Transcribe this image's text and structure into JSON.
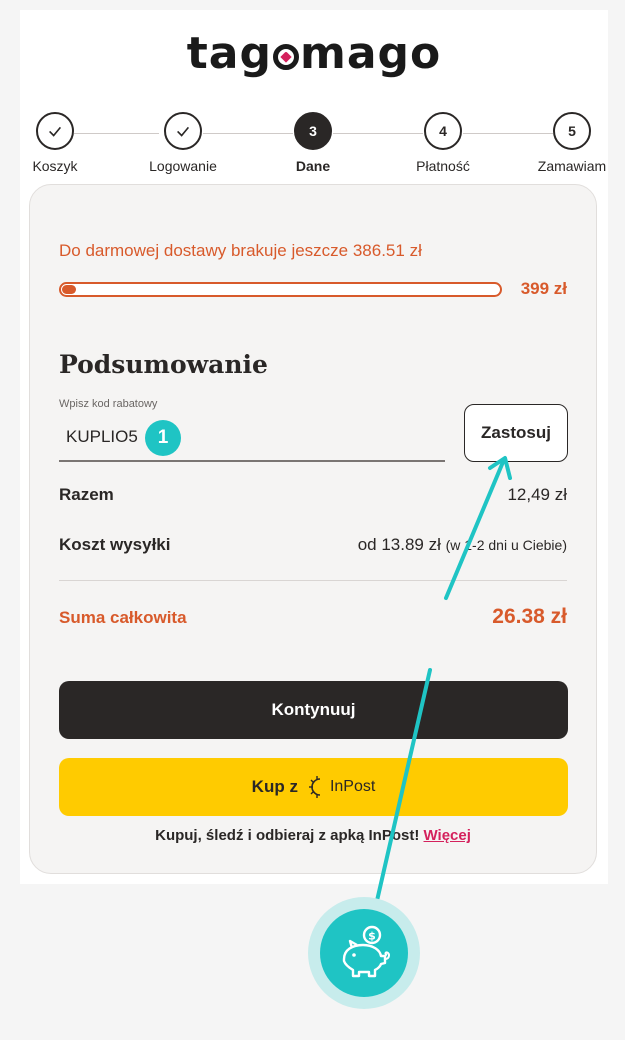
{
  "brand": {
    "logo_text": "tagomago"
  },
  "steps": [
    {
      "number": "1",
      "label": "Koszyk",
      "state": "done"
    },
    {
      "number": "2",
      "label": "Logowanie",
      "state": "done"
    },
    {
      "number": "3",
      "label": "Dane",
      "state": "active"
    },
    {
      "number": "4",
      "label": "Płatność",
      "state": "pending"
    },
    {
      "number": "5",
      "label": "Zamawiam",
      "state": "pending"
    }
  ],
  "shipping": {
    "message": "Do darmowej dostawy brakuje jeszcze 386.51 zł",
    "threshold_label": "399 zł",
    "progress_fraction": 0.031
  },
  "summary": {
    "title": "Podsumowanie",
    "coupon_label": "Wpisz kod rabatowy",
    "coupon_value": "KUPLIO5",
    "apply_label": "Zastosuj",
    "subtotal_label": "Razem",
    "subtotal_value": "12,49 zł",
    "shipping_label": "Koszt wysyłki",
    "shipping_value": "od 13.89 zł",
    "shipping_note": "(w 1-2 dni u Ciebie)",
    "total_label": "Suma całkowita",
    "total_value": "26.38 zł"
  },
  "actions": {
    "continue_label": "Kontynuuj",
    "inpost_prefix": "Kup z",
    "inpost_brand": "InPost",
    "inpost_note": "Kupuj, śledź i odbieraj z apką InPost!",
    "inpost_more": "Więcej"
  },
  "overlay": {
    "badge": "1",
    "accent_color": "#1fc4c4"
  },
  "colors": {
    "accent": "#d85a2b",
    "dark": "#2a2726",
    "inpost_yellow": "#ffcb00",
    "link_pink": "#d4215c"
  }
}
